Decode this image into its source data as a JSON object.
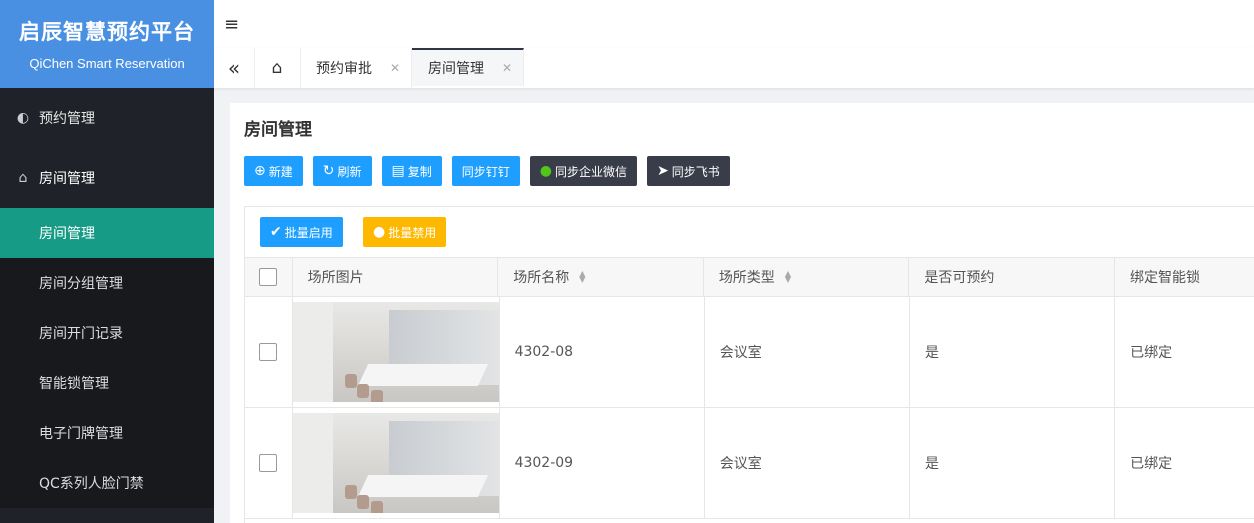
{
  "app": {
    "name": "启辰智慧预约平台",
    "name_en": "QiChen Smart Reservation"
  },
  "sidebar": {
    "groups": [
      {
        "label": "预约管理",
        "icon": "eye-icon"
      },
      {
        "label": "房间管理",
        "icon": "home-icon"
      }
    ],
    "items": [
      {
        "label": "房间管理",
        "active": true
      },
      {
        "label": "房间分组管理"
      },
      {
        "label": "房间开门记录"
      },
      {
        "label": "智能锁管理"
      },
      {
        "label": "电子门牌管理"
      },
      {
        "label": "QC系列人脸门禁"
      }
    ]
  },
  "tabs": [
    {
      "label": "预约审批"
    },
    {
      "label": "房间管理",
      "active": true
    }
  ],
  "page": {
    "title": "房间管理"
  },
  "toolbar": {
    "new": "新建",
    "refresh": "刷新",
    "copy": "复制",
    "sync_dingtalk": "同步钉钉",
    "sync_wecom": "同步企业微信",
    "sync_feishu": "同步飞书"
  },
  "table_tools": {
    "batch_enable": "批量启用",
    "batch_disable": "批量禁用"
  },
  "table": {
    "columns": [
      "场所图片",
      "场所名称",
      "场所类型",
      "是否可预约",
      "绑定智能锁"
    ],
    "rows": [
      {
        "name": "4302-08",
        "type": "会议室",
        "bookable": "是",
        "lock": "已绑定"
      },
      {
        "name": "4302-09",
        "type": "会议室",
        "bookable": "是",
        "lock": "已绑定"
      }
    ]
  },
  "colors": {
    "primary": "#1e9fff",
    "dark_button": "#393d49",
    "warning": "#ffb800",
    "active_menu": "#169c86",
    "logo_bg": "#4a90e2",
    "sidebar_bg": "#1f2329"
  }
}
